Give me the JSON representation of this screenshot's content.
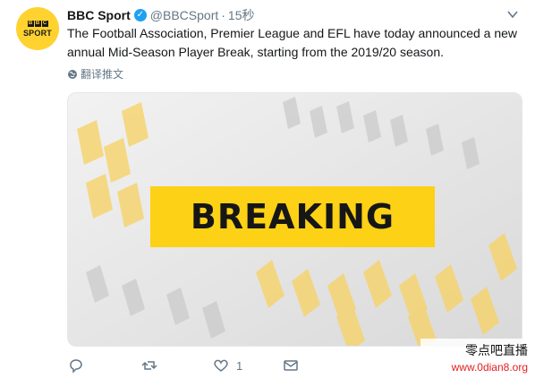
{
  "author": {
    "name": "BBC Sport",
    "handle": "@BBCSport",
    "separator": "·",
    "time": "15秒",
    "avatar_icon": "bbc-sport-logo",
    "avatar_blocks": [
      "B",
      "B",
      "C"
    ],
    "avatar_word": "SPORT",
    "verified_icon": "verified-badge-icon"
  },
  "tweet": {
    "text": "The Football Association, Premier League and EFL have today announced a new annual Mid-Season Player Break, starting from the 2019/20 season.",
    "translate_label": "翻译推文"
  },
  "media": {
    "headline": "BREAKING",
    "accent_color": "#fcd116"
  },
  "actions": {
    "reply_icon": "reply-icon",
    "retweet_icon": "retweet-icon",
    "like_icon": "heart-icon",
    "like_count": "1",
    "dm_icon": "envelope-icon"
  },
  "watermark": {
    "cn": "零点吧直播",
    "url": "www.0dian8.org"
  },
  "colors": {
    "text": "#14171a",
    "muted": "#657786",
    "verified": "#1da1f2",
    "avatar_bg": "#ffd230"
  }
}
